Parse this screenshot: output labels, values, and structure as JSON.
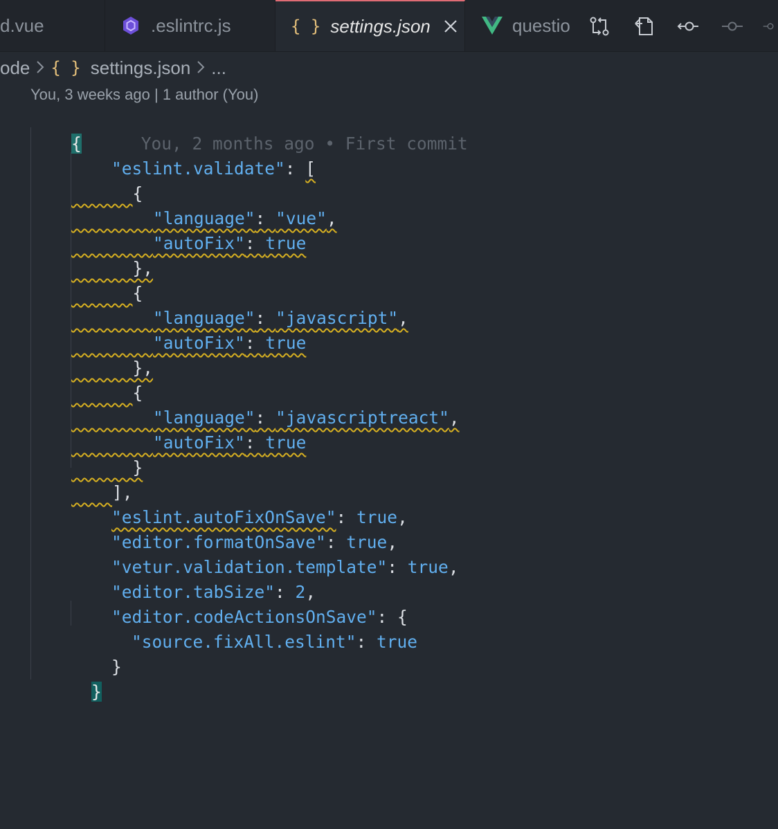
{
  "tabs": [
    {
      "label": "d.vue",
      "icon": "vue-file-icon"
    },
    {
      "label": ".eslintrc.js",
      "icon": "eslint-icon"
    },
    {
      "label": "settings.json",
      "icon": "json-braces-icon",
      "active": true
    },
    {
      "label": "questio",
      "icon": "vue-logo-icon"
    }
  ],
  "tab_actions": [
    "git-compare-icon",
    "open-changes-icon",
    "go-previous-change-icon",
    "go-next-change-icon",
    "more-change-icon"
  ],
  "breadcrumb": {
    "root": "ode",
    "file_icon": "{ }",
    "file": "settings.json",
    "more": "..."
  },
  "codelens": "You, 3 weeks ago | 1 author (You)",
  "blame": "You, 2 months ago • First commit",
  "code": {
    "open_brace": "{",
    "k_validate": "\"eslint.validate\"",
    "colon": ": ",
    "open_bracket": "[",
    "obj_open": "{",
    "obj_close_comma": "},",
    "obj_close": "}",
    "k_language": "\"language\"",
    "k_autofix": "\"autoFix\"",
    "v_vue": "\"vue\"",
    "v_js": "\"javascript\"",
    "v_jsx": "\"javascriptreact\"",
    "comma": ",",
    "true": "true",
    "close_bracket": "],",
    "k_autofixonsave": "\"eslint.autoFixOnSave\"",
    "k_formatonsave": "\"editor.formatOnSave\"",
    "k_vetur": "\"vetur.validation.template\"",
    "k_tabsize": "\"editor.tabSize\"",
    "v_tabsize": "2",
    "k_codeactions": "\"editor.codeActionsOnSave\"",
    "k_fixall": "\"source.fixAll.eslint\"",
    "close_brace": "}"
  },
  "colors": {
    "editor_bg": "#252a31",
    "tab_bar_bg": "#21252b",
    "active_tab_border": "#e06c75",
    "string": "#61afef",
    "warning_squiggle": "#d7b021",
    "json_icon": "#e5c07b",
    "eslint_icon": "#6c4fd8",
    "vue_icon": "#41b883"
  }
}
